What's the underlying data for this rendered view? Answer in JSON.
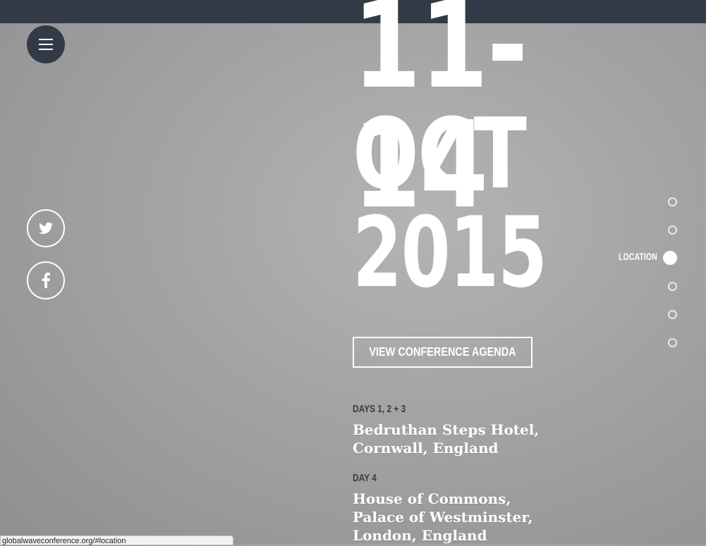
{
  "header": {
    "menu_icon": "hamburger-icon"
  },
  "social": {
    "twitter": {
      "icon": "twitter-icon"
    },
    "facebook": {
      "icon": "facebook-icon"
    }
  },
  "event_dates": {
    "line1": "11-14",
    "line2": "OCT",
    "line3": "2015"
  },
  "agenda_button": {
    "label": "VIEW CONFERENCE AGENDA"
  },
  "locations": [
    {
      "days": "DAYS 1, 2 + 3",
      "venue_line1": "Bedruthan Steps Hotel,",
      "venue_line2": "Cornwall, England"
    },
    {
      "days": "DAY 4",
      "venue_line1": "House of Commons,",
      "venue_line2": "Palace of Westminster,",
      "venue_line3": "London, England"
    }
  ],
  "section_nav": {
    "active_label": "LOCATION",
    "dots": 6,
    "active_index": 2
  },
  "status_bar": {
    "url": "globalwaveconference.org/#location"
  },
  "colors": {
    "navy": "#333a47",
    "white": "#ffffff",
    "background": "#a3a3a3"
  }
}
